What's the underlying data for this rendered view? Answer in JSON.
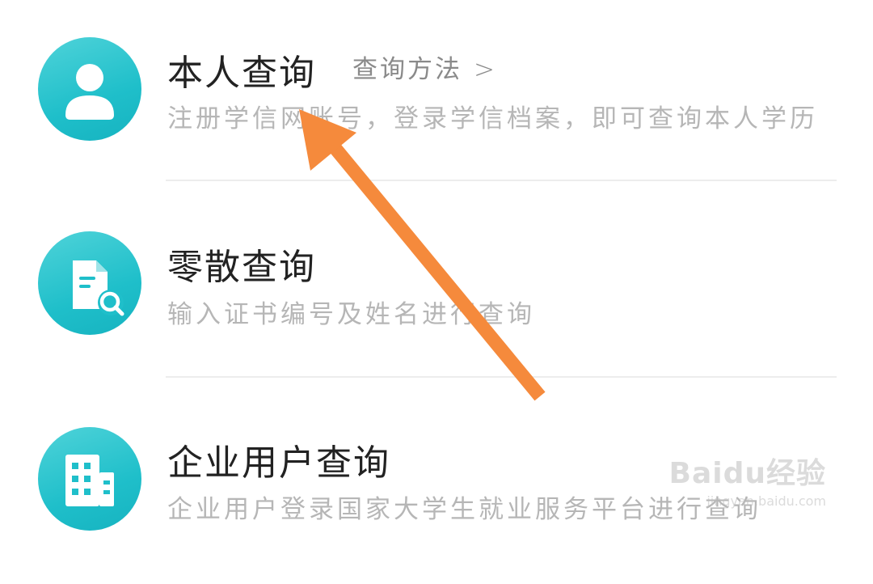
{
  "items": [
    {
      "title": "本人查询",
      "link": "查询方法",
      "link_arrow": ">",
      "subtitle": "注册学信网账号，登录学信档案，即可查询本人学历",
      "icon": "user-icon"
    },
    {
      "title": "零散查询",
      "subtitle": "输入证书编号及姓名进行查询",
      "icon": "document-search-icon"
    },
    {
      "title": "企业用户查询",
      "subtitle": "企业用户登录国家大学生就业服务平台进行查询",
      "icon": "building-icon"
    }
  ],
  "watermark": {
    "brand": "Baidu经验",
    "url": "jingyan.baidu.com"
  },
  "colors": {
    "icon_bg": "#1fbfca",
    "title": "#222222",
    "subtitle": "#b6b6b6",
    "arrow": "#f58a3c"
  }
}
